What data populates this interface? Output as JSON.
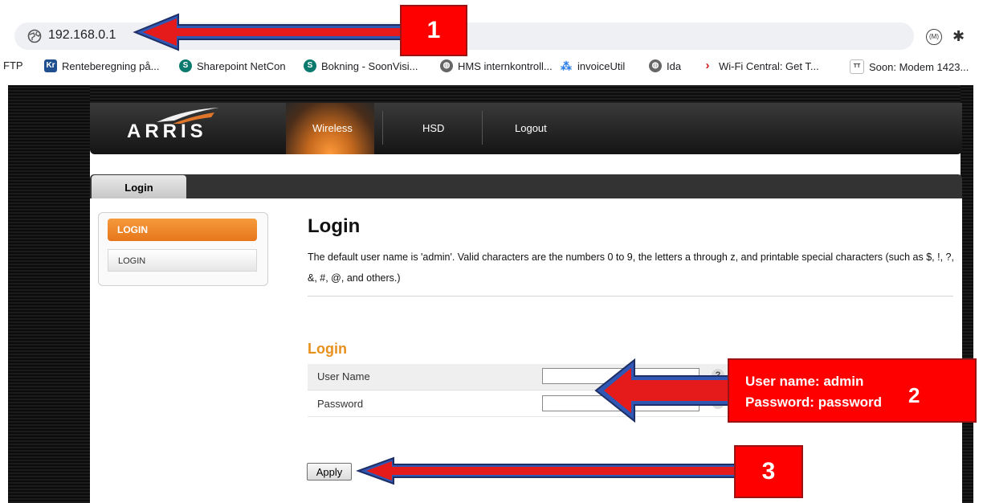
{
  "browser": {
    "url": "192.168.0.1",
    "bookmarks": [
      {
        "label": "FTP",
        "icon": "ftp-icon"
      },
      {
        "label": "Renteberegning på...",
        "icon": "kr-icon"
      },
      {
        "label": "Sharepoint NetCon",
        "icon": "sharepoint-icon"
      },
      {
        "label": "Bokning - SoonVisi...",
        "icon": "sharepoint-icon"
      },
      {
        "label": "HMS internkontroll...",
        "icon": "globe-icon"
      },
      {
        "label": "invoiceUtil",
        "icon": "invoice-icon"
      },
      {
        "label": "Ida",
        "icon": "globe-icon"
      },
      {
        "label": "Wi-Fi Central: Get T...",
        "icon": "chevron-icon"
      },
      {
        "label": "Soon: Modem 1423...",
        "icon": "tatek-icon"
      }
    ],
    "ext_m": "(M)"
  },
  "header": {
    "logo": "ARRIS",
    "nav": [
      "Wireless",
      "HSD",
      "Logout"
    ]
  },
  "tabs": [
    "Login"
  ],
  "sidebar": {
    "heading": "LOGIN",
    "items": [
      "LOGIN"
    ]
  },
  "main": {
    "title": "Login",
    "description": "The default user name is 'admin'. Valid characters are the numbers 0 to 9, the letters a through z, and printable special characters (such as $, !, ?, &, #, @, and others.)",
    "section_title": "Login",
    "fields": [
      {
        "label": "User Name",
        "value": ""
      },
      {
        "label": "Password",
        "value": ""
      }
    ],
    "help_symbol": "?",
    "apply_label": "Apply"
  },
  "annotations": {
    "badge1": "1",
    "badge2": "2",
    "badge3": "3",
    "callout_line1": "User name: admin",
    "callout_line2": "Password: password"
  },
  "colors": {
    "accent_orange": "#e7901c",
    "annotation_red": "#ff0000",
    "arrow_blue": "#3b5aa8"
  }
}
